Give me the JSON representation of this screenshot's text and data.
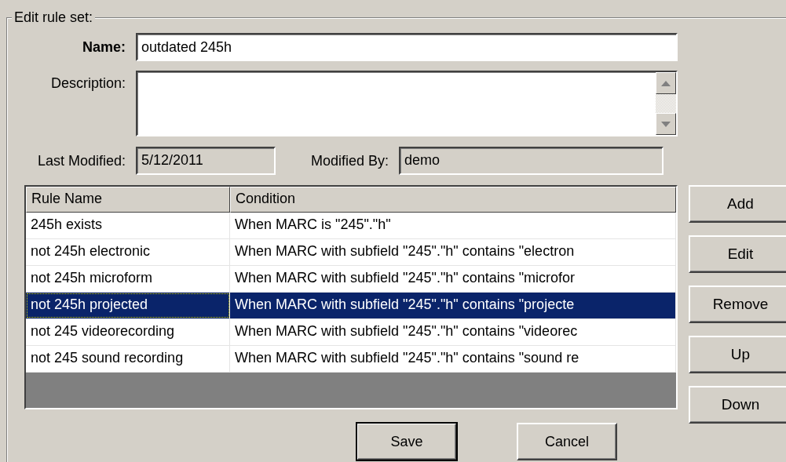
{
  "group": {
    "title": "Edit rule set:"
  },
  "name_field": {
    "label": "Name:",
    "required": true,
    "value": "outdated 245h"
  },
  "description_field": {
    "label": "Description:",
    "required": false
  },
  "last_modified": {
    "label": "Last Modified:",
    "value": "5/12/2011"
  },
  "modified_by": {
    "label": "Modified By:",
    "value": "demo"
  },
  "table": {
    "columns": [
      "Rule Name",
      "Condition"
    ],
    "rows": [
      {
        "cells": [
          "245h exists",
          "When MARC is \"245\".\"h\""
        ],
        "selected": false,
        "focused": false
      },
      {
        "cells": [
          "not 245h electronic",
          "When MARC with subfield \"245\".\"h\" contains \"electron"
        ],
        "selected": false,
        "focused": false
      },
      {
        "cells": [
          "not 245h microform",
          "When MARC with subfield \"245\".\"h\" contains \"microfor"
        ],
        "selected": false,
        "focused": false
      },
      {
        "cells": [
          "not 245h projected",
          "When MARC with subfield \"245\".\"h\" contains \"projecte"
        ],
        "selected": true,
        "focused": true
      },
      {
        "cells": [
          "not 245 videorecording",
          "When MARC with subfield \"245\".\"h\" contains \"videorec"
        ],
        "selected": false,
        "focused": false
      },
      {
        "cells": [
          "not 245 sound recording",
          "When MARC with subfield \"245\".\"h\" contains \"sound re"
        ],
        "selected": false,
        "focused": false
      }
    ]
  },
  "side_buttons": [
    "Add",
    "Edit",
    "Remove",
    "Up",
    "Down"
  ],
  "bottom_buttons": [
    {
      "label": "Save",
      "default": true
    },
    {
      "label": "Cancel",
      "default": false
    }
  ]
}
